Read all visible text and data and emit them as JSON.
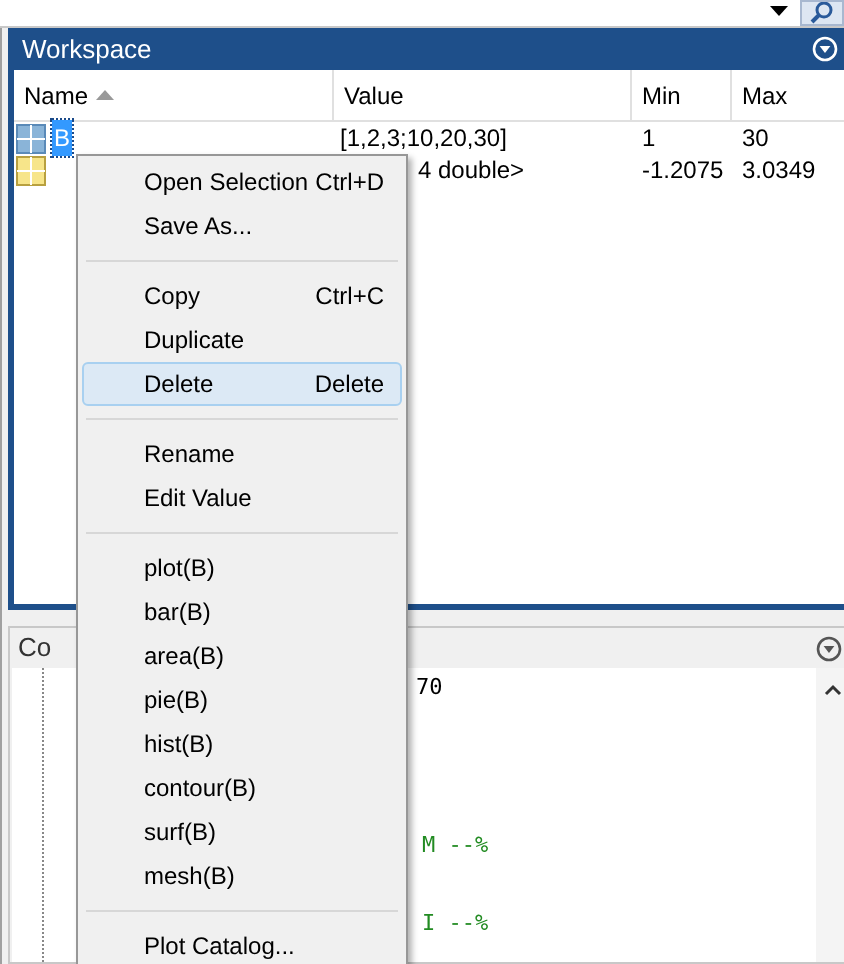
{
  "workspace": {
    "title": "Workspace",
    "columns": [
      {
        "label": "Name",
        "sorted": true
      },
      {
        "label": "Value",
        "sorted": false
      },
      {
        "label": "Min",
        "sorted": false
      },
      {
        "label": "Max",
        "sorted": false
      }
    ],
    "rows": [
      {
        "name": "B",
        "value": "[1,2,3;10,20,30]",
        "min": "1",
        "max": "30",
        "selected": true
      },
      {
        "name": "",
        "value": "4 double>",
        "min": "-1.2075",
        "max": "3.0349",
        "selected": false
      }
    ]
  },
  "command_history": {
    "title": "Co",
    "lines": [
      {
        "text": "70",
        "kind": "plain"
      },
      {
        "text": "M --%",
        "kind": "section"
      },
      {
        "text": "I --%",
        "kind": "section"
      }
    ]
  },
  "context_menu": [
    {
      "kind": "item",
      "label": "Open Selection",
      "shortcut": "Ctrl+D",
      "selected": false
    },
    {
      "kind": "item",
      "label": "Save As...",
      "selected": false
    },
    {
      "kind": "separator"
    },
    {
      "kind": "item",
      "label": "Copy",
      "shortcut": "Ctrl+C",
      "selected": false
    },
    {
      "kind": "item",
      "label": "Duplicate",
      "selected": false
    },
    {
      "kind": "item",
      "label": "Delete",
      "shortcut": "Delete",
      "selected": true
    },
    {
      "kind": "separator"
    },
    {
      "kind": "item",
      "label": "Rename",
      "selected": false
    },
    {
      "kind": "item",
      "label": "Edit Value",
      "selected": false
    },
    {
      "kind": "separator"
    },
    {
      "kind": "item",
      "label": "plot(B)",
      "selected": false
    },
    {
      "kind": "item",
      "label": "bar(B)",
      "selected": false
    },
    {
      "kind": "item",
      "label": "area(B)",
      "selected": false
    },
    {
      "kind": "item",
      "label": "pie(B)",
      "selected": false
    },
    {
      "kind": "item",
      "label": "hist(B)",
      "selected": false
    },
    {
      "kind": "item",
      "label": "contour(B)",
      "selected": false
    },
    {
      "kind": "item",
      "label": "surf(B)",
      "selected": false
    },
    {
      "kind": "item",
      "label": "mesh(B)",
      "selected": false
    },
    {
      "kind": "separator"
    },
    {
      "kind": "item",
      "label": "Plot Catalog...",
      "selected": false
    }
  ]
}
